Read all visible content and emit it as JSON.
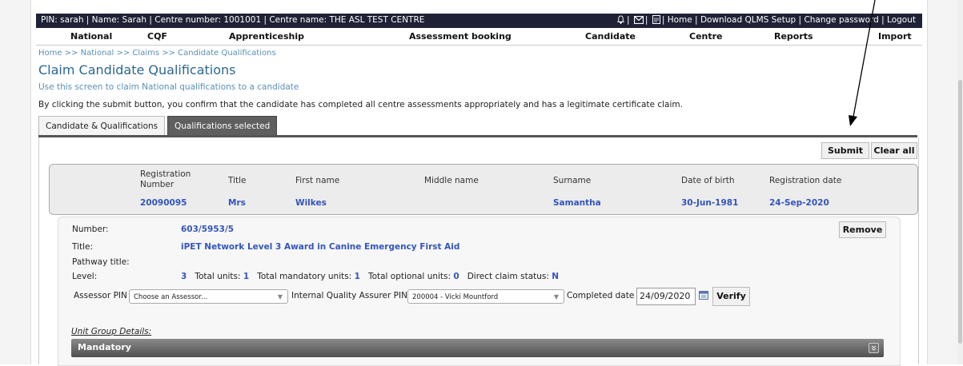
{
  "topbar": {
    "info": "PIN: sarah | Name: Sarah | Centre number: 1001001 | Centre name: THE ASL TEST CENTRE",
    "home": "Home",
    "download": "Download QLMS Setup",
    "change_password": "Change password",
    "logout": "Logout"
  },
  "menu": {
    "national": "National",
    "cqf": "CQF",
    "apprenticeship": "Apprenticeship",
    "assessment_booking": "Assessment booking",
    "candidate": "Candidate",
    "centre": "Centre",
    "reports": "Reports",
    "import": "Import"
  },
  "breadcrumb": "Home >> National >> Claims >> Candidate Qualifications",
  "page": {
    "title": "Claim Candidate Qualifications",
    "subtitle": "Use this screen to claim National qualifications to a candidate",
    "note": "By clicking the submit button, you confirm that the candidate has completed all centre assessments appropriately and has a legitimate certificate claim."
  },
  "tabs": {
    "candidate_quals": "Candidate & Qualifications",
    "quals_selected": "Qualifications selected"
  },
  "buttons": {
    "submit": "Submit",
    "clear_all": "Clear all",
    "remove": "Remove",
    "verify": "Verify"
  },
  "candidate": {
    "headers": {
      "reg_number": "Registration Number",
      "title": "Title",
      "first_name": "First name",
      "middle_name": "Middle name",
      "surname": "Surname",
      "dob": "Date of birth",
      "reg_date": "Registration date"
    },
    "values": {
      "reg_number": "20090095",
      "title": "Mrs",
      "first_name": "Wilkes",
      "middle_name": "",
      "surname": "Samantha",
      "dob": "30-Jun-1981",
      "reg_date": "24-Sep-2020"
    }
  },
  "qualification": {
    "number_label": "Number:",
    "number": "603/5953/5",
    "title_label": "Title:",
    "title": "iPET Network Level 3 Award in Canine Emergency First Aid",
    "pathway_label": "Pathway title:",
    "pathway": "",
    "level_label": "Level:",
    "level": "3",
    "total_units_label": "Total units:",
    "total_units": "1",
    "total_mandatory_label": "Total mandatory units:",
    "total_mandatory": "1",
    "total_optional_label": "Total optional units:",
    "total_optional": "0",
    "direct_claim_label": "Direct claim status:",
    "direct_claim": "N",
    "assessor_label": "Assessor PIN",
    "assessor_value": "Choose an Assessor...",
    "iqa_label": "Internal Quality Assurer PIN",
    "iqa_value": "200004 - Vicki Mountford",
    "completed_label": "Completed date",
    "completed_date": "24/09/2020",
    "unit_group_label": "Unit Group Details:",
    "mandatory_label": "Mandatory"
  }
}
